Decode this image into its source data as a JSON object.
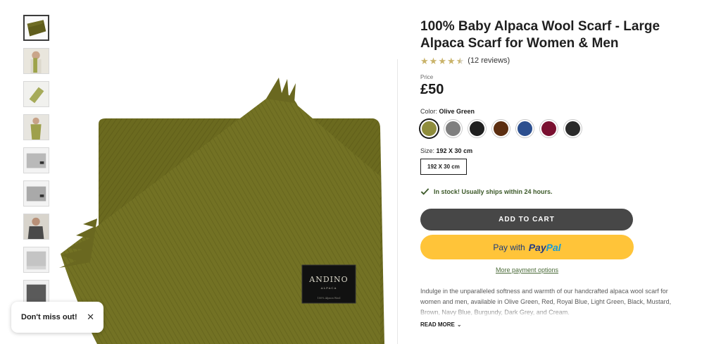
{
  "thumbnails": [
    {
      "label": "olive-folded"
    },
    {
      "label": "model-wearing"
    },
    {
      "label": "scarf-flat"
    },
    {
      "label": "model-neck"
    },
    {
      "label": "grey-scarf-1"
    },
    {
      "label": "grey-scarf-2"
    },
    {
      "label": "model-dark"
    },
    {
      "label": "grey-fringe"
    },
    {
      "label": "dark-scarf"
    }
  ],
  "main_image": {
    "brand_label": "ANDINO",
    "sub_label": "ALPACA",
    "tag_line": "100% Alpaca Wool"
  },
  "product": {
    "title": "100% Baby Alpaca Wool Scarf - Large Alpaca Scarf for Women & Men",
    "reviews": "(12 reviews)",
    "rating": 4.5,
    "price_label": "Price",
    "price": "£50",
    "color_label": "Color:",
    "color_value": "Olive Green",
    "colors": [
      "#8f8d3c",
      "#7f7f7f",
      "#1f1f1f",
      "#5c2e10",
      "#2c4f8f",
      "#7a1030",
      "#2a2a2a"
    ],
    "size_label": "Size:",
    "size_value": "192 X 30 cm",
    "size_option": "192 X 30 cm",
    "stock": "In stock! Usually ships within 24 hours.",
    "add_to_cart": "ADD TO CART",
    "paypal_prefix": "Pay with",
    "paypal_logo_1": "Pay",
    "paypal_logo_2": "Pal",
    "more_payment": "More payment options",
    "description": "Indulge in the unparalleled softness and warmth of our handcrafted alpaca wool scarf for women and men, available in Olive Green, Red, Royal Blue, Light Green, Black, Mustard, Brown, Navy Blue, Burgundy, Dark Grey, and Cream.",
    "read_more": "READ MORE"
  },
  "popup": {
    "text": "Don't miss out!",
    "close": "✕"
  },
  "colors": {
    "accent_green": "#3d5a2a",
    "cart_bg": "#474747",
    "paypal_bg": "#ffc439",
    "star": "#c9b36a"
  }
}
